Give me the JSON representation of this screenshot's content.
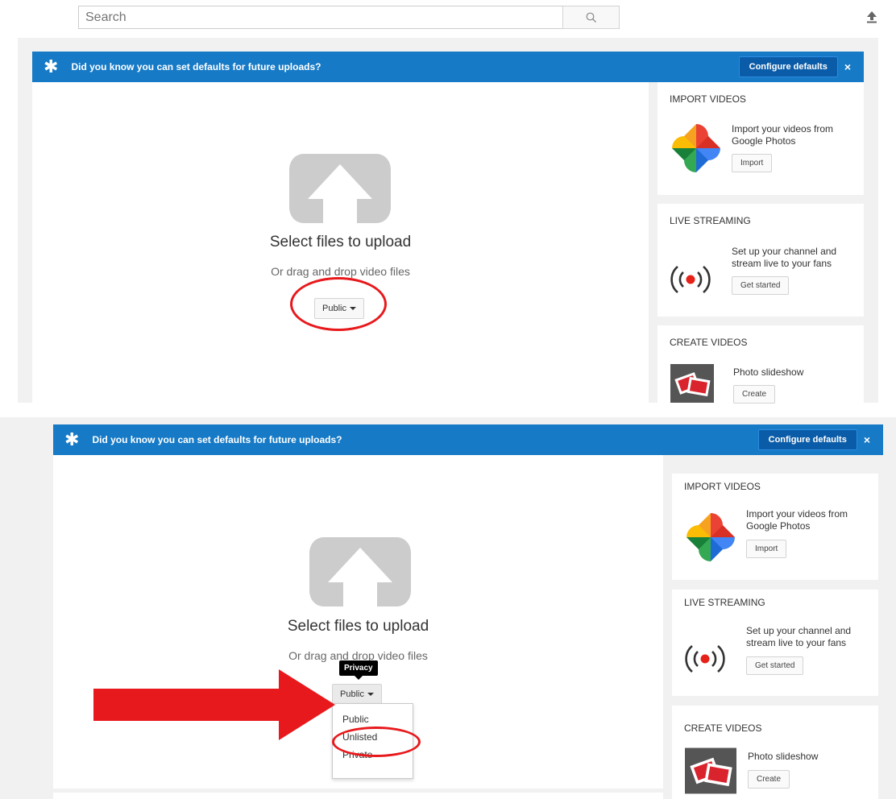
{
  "search": {
    "placeholder": "Search"
  },
  "header": {
    "upload_icon": "upload-arrow-icon"
  },
  "banner": {
    "icon": "star-icon",
    "message": "Did you know you can set defaults for future uploads?",
    "configure_label": "Configure defaults",
    "close_glyph": "×"
  },
  "upload": {
    "title": "Select files to upload",
    "subtitle": "Or drag and drop video files",
    "privacy_value": "Public",
    "privacy_tooltip": "Privacy",
    "privacy_options": [
      "Public",
      "Unlisted",
      "Private"
    ]
  },
  "sidebar": {
    "import": {
      "title": "IMPORT VIDEOS",
      "line1": "Import your videos from",
      "line2": "Google Photos",
      "button": "Import"
    },
    "live": {
      "title": "LIVE STREAMING",
      "line1": "Set up your channel and",
      "line2": "stream live to your fans",
      "button": "Get started"
    },
    "create": {
      "title": "CREATE VIDEOS",
      "line1": "Photo slideshow",
      "button": "Create"
    }
  },
  "colors": {
    "banner": "#167ac6",
    "page_bg": "#f1f1f1",
    "highlight": "#e8191c",
    "live_red": "#e62117"
  }
}
